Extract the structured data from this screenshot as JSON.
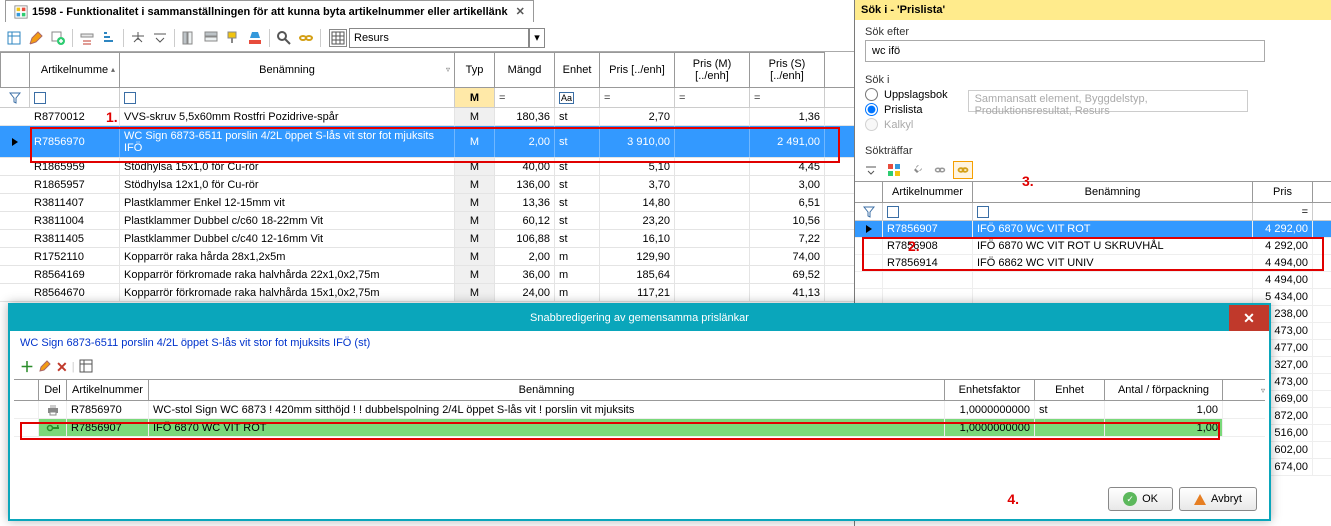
{
  "tab": {
    "title": "1598 - Funktionalitet i sammanställningen för att kunna byta artikelnummer eller artikellänk",
    "close": "✕"
  },
  "toolbar": {
    "resource_label": "Resurs"
  },
  "main_grid": {
    "headers": {
      "art": "Artikelnumme",
      "ben": "Benämning",
      "typ": "Typ",
      "mangd": "Mängd",
      "enhet": "Enhet",
      "pris": "Pris [../enh]",
      "prism": "Pris (M) [../enh]",
      "priss": "Pris (S) [../enh]"
    },
    "filter": {
      "typ": "M",
      "enhet": "Aa",
      "eq": "="
    },
    "rows": [
      {
        "art": "R8770012",
        "ben": "VVS-skruv 5,5x60mm Rostfri Pozidrive-spår",
        "typ": "M",
        "mangd": "180,36",
        "enhet": "st",
        "pris": "2,70",
        "prism": "",
        "priss": "1,36"
      },
      {
        "art": "R7856970",
        "ben": "WC Sign 6873-6511 porslin 4/2L öppet S-lås vit stor fot mjuksits IFÖ",
        "typ": "M",
        "mangd": "2,00",
        "enhet": "st",
        "pris": "3 910,00",
        "prism": "",
        "priss": "2 491,00",
        "selected": true
      },
      {
        "art": "R1865959",
        "ben": "Stödhylsa 15x1,0 för Cu-rör",
        "typ": "M",
        "mangd": "40,00",
        "enhet": "st",
        "pris": "5,10",
        "prism": "",
        "priss": "4,45"
      },
      {
        "art": "R1865957",
        "ben": "Stödhylsa 12x1,0 för Cu-rör",
        "typ": "M",
        "mangd": "136,00",
        "enhet": "st",
        "pris": "3,70",
        "prism": "",
        "priss": "3,00"
      },
      {
        "art": "R3811407",
        "ben": "Plastklammer Enkel 12-15mm vit",
        "typ": "M",
        "mangd": "13,36",
        "enhet": "st",
        "pris": "14,80",
        "prism": "",
        "priss": "6,51"
      },
      {
        "art": "R3811004",
        "ben": "Plastklammer Dubbel c/c60 18-22mm Vit",
        "typ": "M",
        "mangd": "60,12",
        "enhet": "st",
        "pris": "23,20",
        "prism": "",
        "priss": "10,56"
      },
      {
        "art": "R3811405",
        "ben": "Plastklammer Dubbel c/c40 12-16mm Vit",
        "typ": "M",
        "mangd": "106,88",
        "enhet": "st",
        "pris": "16,10",
        "prism": "",
        "priss": "7,22"
      },
      {
        "art": "R1752110",
        "ben": "Kopparrör raka hårda 28x1,2x5m",
        "typ": "M",
        "mangd": "2,00",
        "enhet": "m",
        "pris": "129,90",
        "prism": "",
        "priss": "74,00"
      },
      {
        "art": "R8564169",
        "ben": "Kopparrör förkromade raka halvhårda 22x1,0x2,75m",
        "typ": "M",
        "mangd": "36,00",
        "enhet": "m",
        "pris": "185,64",
        "prism": "",
        "priss": "69,52"
      },
      {
        "art": "R8564670",
        "ben": "Kopparrör förkromade raka halvhårda 15x1,0x2,75m",
        "typ": "M",
        "mangd": "24,00",
        "enhet": "m",
        "pris": "117,21",
        "prism": "",
        "priss": "41,13"
      }
    ]
  },
  "annotations": {
    "a1": "1.",
    "a2": "2.",
    "a3": "3.",
    "a4": "4."
  },
  "search_panel": {
    "title": "Sök i -  'Prislista'",
    "sok_efter_label": "Sök efter",
    "sok_efter_value": "wc ifö",
    "sok_i_label": "Sök i",
    "radio1": "Uppslagsbok",
    "radio2": "Prislista",
    "radio3": "Kalkyl",
    "placeholder": "Sammansatt element, Byggdelstyp, Produktionsresultat, Resurs",
    "soktraffar": "Sökträffar",
    "headers": {
      "art": "Artikelnummer",
      "ben": "Benämning",
      "pris": "Pris"
    },
    "rows": [
      {
        "art": "R7856907",
        "ben": "IFÖ 6870 WC VIT ROT",
        "pris": "4 292,00",
        "selected": true
      },
      {
        "art": "R7856908",
        "ben": "IFÖ 6870 WC VIT ROT U SKRUVHÅL",
        "pris": "4 292,00"
      },
      {
        "art": "R7856914",
        "ben": "IFÖ 6862 WC VIT UNIV",
        "pris": "4 494,00"
      },
      {
        "art": "",
        "ben": "",
        "pris": "4 494,00"
      },
      {
        "art": "",
        "ben": "",
        "pris": "5 434,00"
      },
      {
        "art": "",
        "ben": "",
        "pris": "2 238,00"
      },
      {
        "art": "",
        "ben": "",
        "pris": "3 473,00"
      },
      {
        "art": "",
        "ben": "",
        "pris": "4 477,00"
      },
      {
        "art": "",
        "ben": "",
        "pris": "4 327,00"
      },
      {
        "art": "",
        "ben": "",
        "pris": "3 473,00"
      },
      {
        "art": "",
        "ben": "",
        "pris": "4 669,00"
      },
      {
        "art": "",
        "ben": "",
        "pris": "7 872,00"
      },
      {
        "art": "",
        "ben": "",
        "pris": "3 516,00"
      },
      {
        "art": "",
        "ben": "",
        "pris": "3 602,00"
      },
      {
        "art": "",
        "ben": "",
        "pris": "3 674,00"
      }
    ]
  },
  "dialog": {
    "title": "Snabbredigering av gemensamma prislänkar",
    "close": "✕",
    "subtitle": "WC Sign 6873-6511 porslin 4/2L öppet S-lås vit stor fot mjuksits IFÖ (st)",
    "headers": {
      "del": "Del",
      "art": "Artikelnummer",
      "ben": "Benämning",
      "ef": "Enhetsfaktor",
      "en": "Enhet",
      "af": "Antal / förpackning"
    },
    "rows": [
      {
        "icon": "print",
        "art": "R7856970",
        "ben": "WC-stol Sign WC 6873 ! 420mm sitthöjd ! ! dubbelspolning 2/4L öppet S-lås vit ! porslin vit mjuksits",
        "ef": "1,0000000000",
        "en": "st",
        "af": "1,00"
      },
      {
        "icon": "key",
        "art": "R7856907",
        "ben": "IFÖ 6870 WC VIT ROT",
        "ef": "1,0000000000",
        "en": "",
        "af": "1,00",
        "green": true
      }
    ],
    "ok": "OK",
    "cancel": "Avbryt"
  }
}
